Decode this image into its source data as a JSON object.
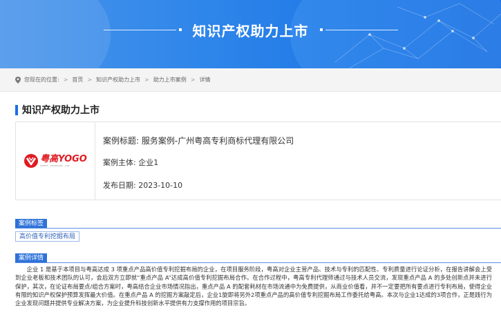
{
  "banner": {
    "title": "知识产权助力上市"
  },
  "breadcrumb": {
    "prefix": "您现在的位置:",
    "items": [
      "首页",
      "知识产权助力上市",
      "助力上市案例",
      "详情"
    ]
  },
  "section": {
    "title": "知识产权助力上市"
  },
  "case": {
    "logo_text": "粤高YOGO",
    "logo_sub": "PATENT · TRADEMARK · LAW",
    "title": "案例标题: 服务案例-广州粤高专利商标代理有限公司",
    "subject": "案例主体: 企业1",
    "date": "发布日期: 2023-10-10"
  },
  "tags": {
    "label": "案例标签",
    "items": [
      "高价值专利挖掘布局"
    ]
  },
  "detail": {
    "label": "案例详情",
    "text": "企业 1 是基于本项目与粤高达成 3 项重点产品高价值专利挖掘布局的企业，在项目服务阶段，粤高对企业主营产品、技术与专利的匹配性、专利质量进行论证分析，在报告讲解会上受到企业老板和技术团队的认可，会后双方立即就“重点产品 A”达成高价值专利挖掘布局合作。在合作过程中，粤高专利代理师通过与技术人员交流，发现重点产品 A 的多处创新点并未进行保护，其次，在论证布局要点/组合方案时，粤高结合企业市场情况指出，重点产品 A 的配套耗材在市场流通中为免费提供，从商业价值看，并不一定要把所有要点进行专利布局，使得企业有限的知识产权保护预算发挥最大价值。在重点产品 A 的挖掘方案敲定后，企业1旋即将另外2项重点产品的高价值专利挖掘布局工作委托给粤高。本次与企业1达成的3项合作，正是践行为企业发现问题并提供专业解决方案，为企业提升科技创新水平提供有力支撑作用的项目宗旨。"
  },
  "colors": {
    "brand_blue": "#1a6ee6",
    "tag_blue": "#2e72d9",
    "logo_red": "#e11b22"
  }
}
